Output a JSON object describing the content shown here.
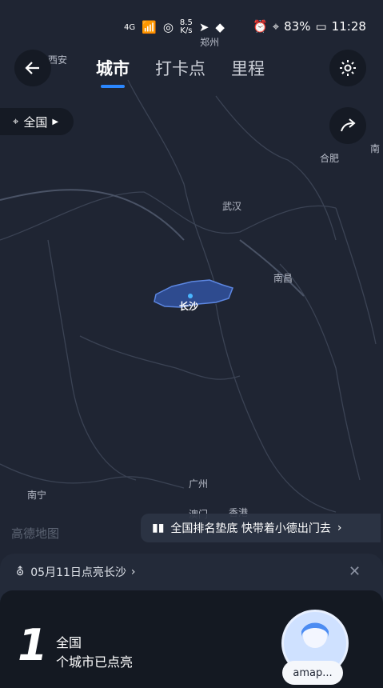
{
  "status_bar": {
    "network": "4G",
    "speed_value": "8.5",
    "speed_unit": "K/s",
    "battery": "83%",
    "time": "11:28"
  },
  "header": {
    "tabs": [
      "城市",
      "打卡点",
      "里程"
    ],
    "active_tab": "城市"
  },
  "region_filter": {
    "label": "全国"
  },
  "map": {
    "provider_watermark": "高德地图",
    "cities": [
      "郑州",
      "西安",
      "合肥",
      "武汉",
      "南昌",
      "长沙",
      "南宁",
      "广州",
      "香港",
      "南",
      "澳门"
    ],
    "highlighted_city": "长沙",
    "colors": {
      "background": "#1f2533",
      "highlight": "#2e4b8f",
      "highlight_border": "#5c86e0",
      "dot": "#49b6ff"
    }
  },
  "rank_banner": {
    "text": "全国排名垫底 快带着小德出门去"
  },
  "bottom_sheet": {
    "notice": "05月11日点亮长沙",
    "stat": {
      "count": "1",
      "scope": "全国",
      "description": "个城市已点亮"
    },
    "user_pill": "amap..."
  }
}
